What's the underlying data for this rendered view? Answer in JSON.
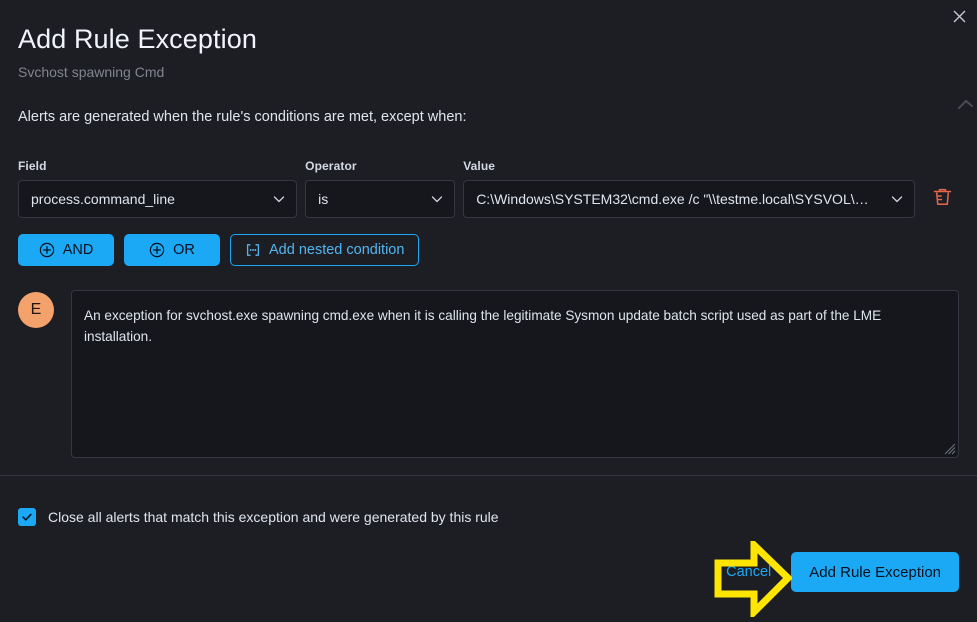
{
  "dialog": {
    "title": "Add Rule Exception",
    "subtitle": "Svchost spawning Cmd",
    "intro": "Alerts are generated when the rule's conditions are met, except when:",
    "close_icon": "close-icon"
  },
  "condition": {
    "field_label": "Field",
    "field_value": "process.command_line",
    "operator_label": "Operator",
    "operator_value": "is",
    "value_label": "Value",
    "value_value": "C:\\Windows\\SYSTEM32\\cmd.exe /c \"\\\\testme.local\\SYSVOL\\…",
    "delete_icon": "trash-icon",
    "chevron_icon": "chevron-down-icon"
  },
  "logic": {
    "and_label": "AND",
    "or_label": "OR",
    "nested_label": "Add nested condition",
    "plus_icon": "plus-in-circle-icon",
    "nested_icon": "nested-condition-icon"
  },
  "comment": {
    "avatar_initial": "E",
    "text": "An exception for svchost.exe spawning cmd.exe when it is calling the legitimate Sysmon update batch script used as part of the LME installation."
  },
  "footer": {
    "checkbox_label": "Close all alerts that match this exception and were generated by this rule",
    "checkbox_checked": true,
    "cancel_label": "Cancel",
    "submit_label": "Add Rule Exception"
  },
  "annotation": {
    "arrow_color": "#ffe500",
    "arrow_name": "highlight-arrow"
  },
  "colors": {
    "background": "#1d1e24",
    "accent": "#1ba9f5",
    "danger": "#e7664c",
    "avatar": "#f3a26b",
    "border": "#343741"
  }
}
